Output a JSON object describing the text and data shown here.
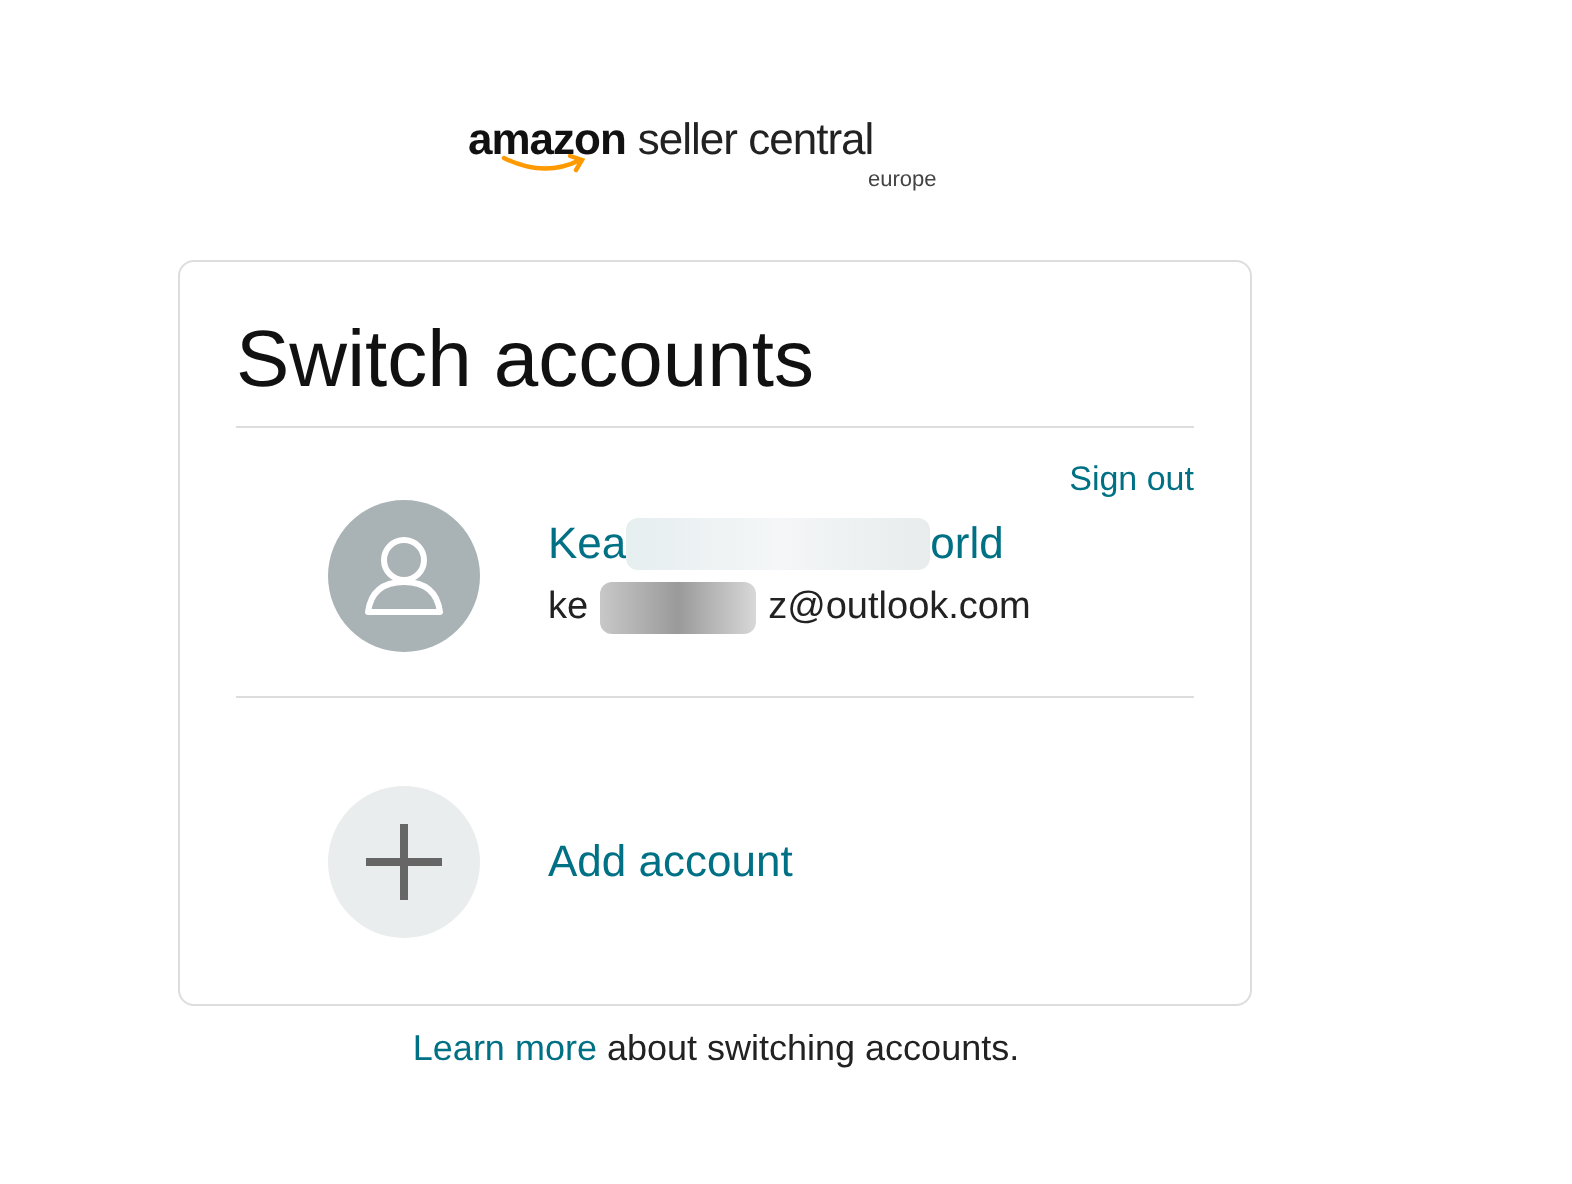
{
  "logo": {
    "brand": "amazon",
    "product": "seller central",
    "region": "europe"
  },
  "card": {
    "title": "Switch accounts",
    "sign_out": "Sign out",
    "account": {
      "name_start": "Kea",
      "name_end": "orld",
      "email_start": "ke",
      "email_end": "z@outlook.com",
      "redacted": true
    },
    "add_account": "Add account"
  },
  "footer": {
    "link": "Learn more",
    "text": " about switching accounts."
  }
}
